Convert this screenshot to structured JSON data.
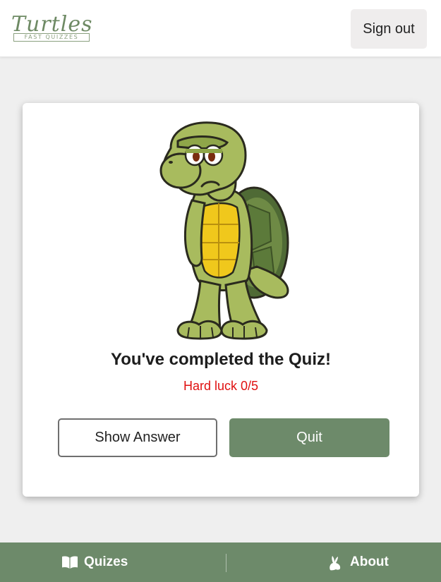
{
  "header": {
    "logo": {
      "title": "Turtles",
      "subtitle": "FAST QUIZZES"
    },
    "sign_out_label": "Sign out"
  },
  "result": {
    "title": "You've completed the Quiz!",
    "score_text": "Hard luck 0/5",
    "image_icon": "sad-turtle-illustration"
  },
  "actions": {
    "show_answer_label": "Show Answer",
    "quit_label": "Quit"
  },
  "footer": {
    "items": [
      {
        "label": "Quizes",
        "icon": "open-book-icon"
      },
      {
        "label": "About",
        "icon": "rabbit-icon"
      }
    ]
  },
  "colors": {
    "brand_green": "#6d8a6a",
    "score_red": "#e01010",
    "page_background": "#efefef"
  }
}
